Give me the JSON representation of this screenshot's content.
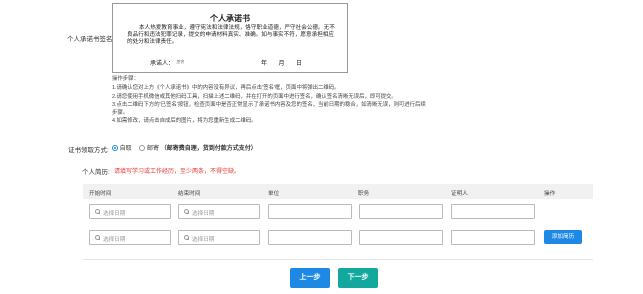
{
  "promise": {
    "field_label": "个人承诺书签名:",
    "title": "个人承诺书",
    "body": "本人热爱教育事业，遵守宪法和法律法规，恪守职业道德，严守社会公德。无不良品行和违法犯罪记录，提交的申请材料真实、准确。如与事实不符，愿意承担相应的处分和法律责任。",
    "signer_label": "承诺人：",
    "signature": "签名",
    "date_label": "年 月 日"
  },
  "steps": {
    "title": "操作步骤：",
    "items": [
      "1.请确认您对上方《个人承诺书》中的内容没有异议，再后点击'签名'框，页面中将弹出二维码。",
      "2.请您使用手机微信或其他扫码工具，扫描上述二维码，并在打开的页面中进行签名，确认签名清晰无误后，即可提交。",
      "3.点击二维码下方的'已签名'按钮，检查页面中是否正常显示了承诺书内容及您的签名，当前日期的稳合，如清晰无误，则可进行后续",
      "步骤。",
      "4.如需修改，请点击自成后的图片，将为您重新生成二维码。"
    ]
  },
  "cert": {
    "label": "证书领取方式:",
    "opt_self": "自取",
    "opt_mail": "邮寄",
    "note": "（邮寄费自理，货到付款方式支付）"
  },
  "resume": {
    "label": "个人简历:",
    "hint": "请填写学习或工作经历，至少两条，不得空缺。",
    "columns": [
      "开始时间",
      "结束时间",
      "单位",
      "职务",
      "证明人",
      "操作"
    ],
    "date_placeholder": "选择日期",
    "add_button": "添加简历"
  },
  "nav": {
    "prev": "上一步",
    "next": "下一步"
  },
  "colors": {
    "primary": "#1e88e5",
    "success": "#13a89e",
    "danger": "#e53935"
  }
}
